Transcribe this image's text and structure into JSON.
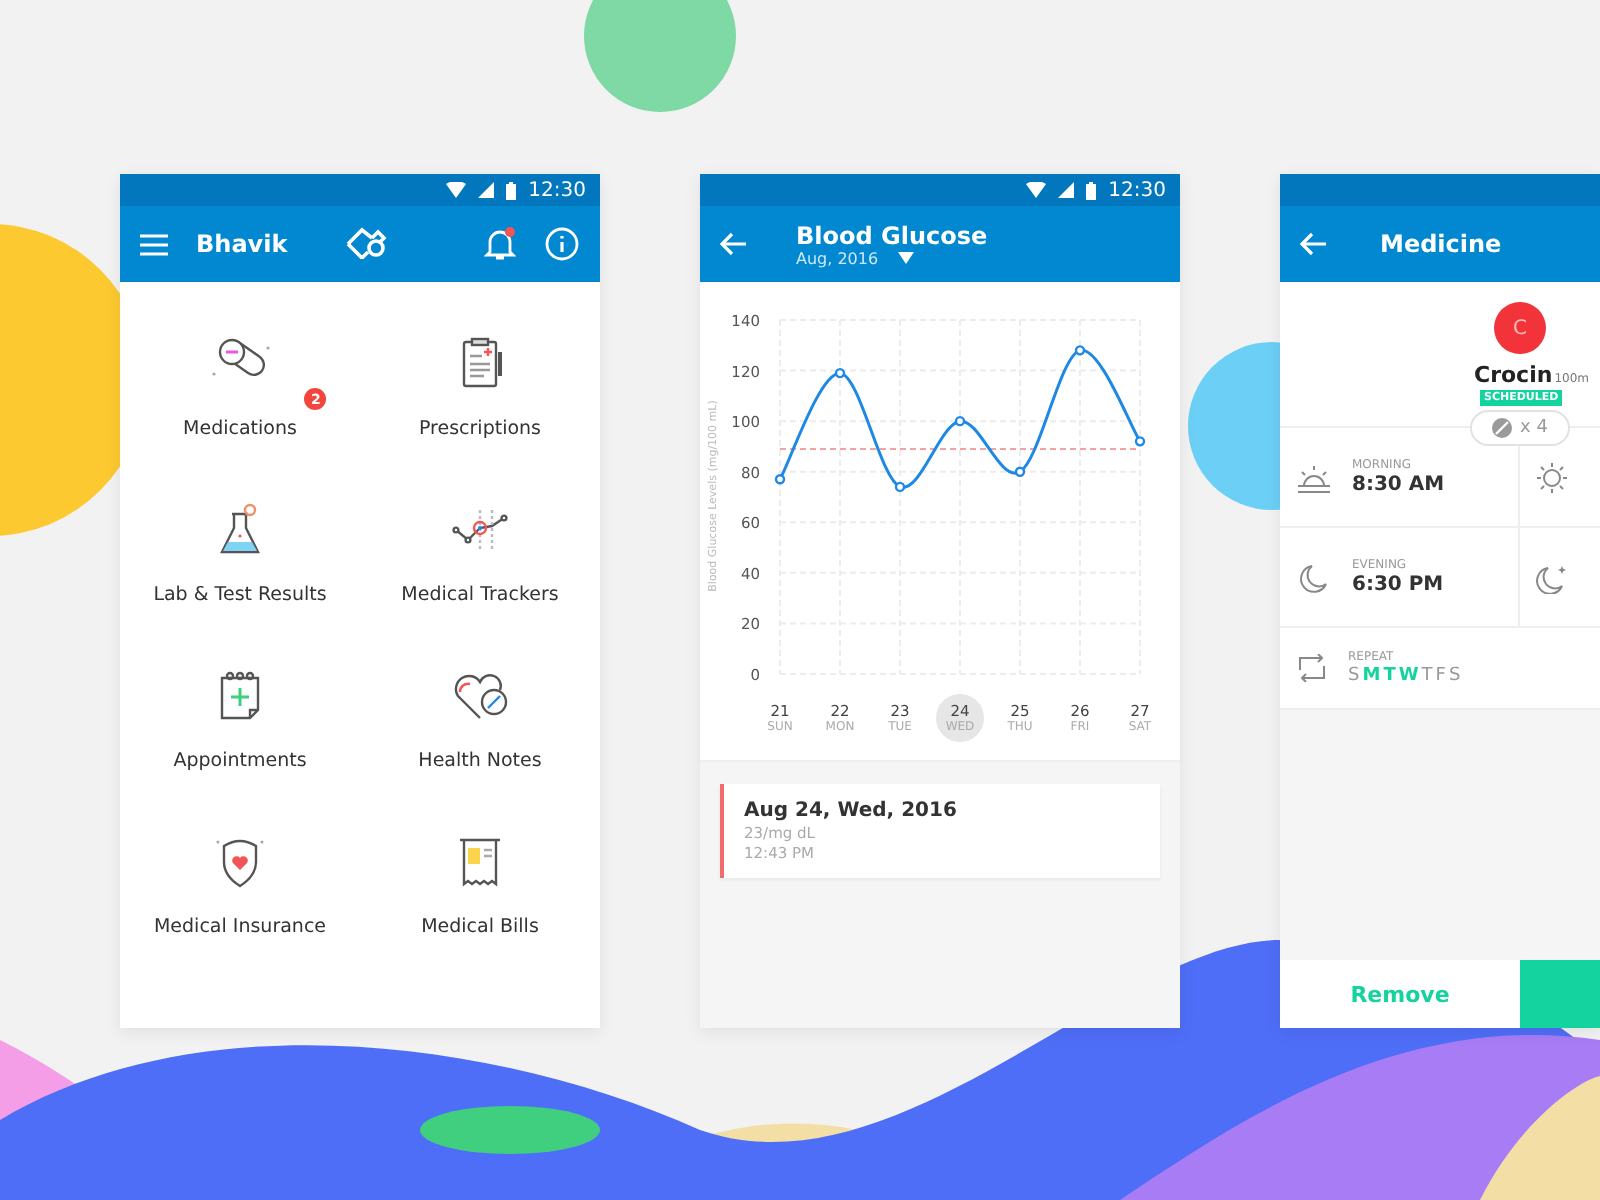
{
  "home_screen": {
    "status_bar": {
      "time": "12:30"
    },
    "app_bar": {
      "title": "Bhavik",
      "notification_dot": true
    },
    "tiles": [
      {
        "kind": "pills",
        "label": "Medications",
        "badge": "2"
      },
      {
        "kind": "clipboard",
        "label": "Prescriptions"
      },
      {
        "kind": "flask",
        "label": "Lab & Test Results"
      },
      {
        "kind": "tracker",
        "label": "Medical Trackers"
      },
      {
        "kind": "calendar",
        "label": "Appointments"
      },
      {
        "kind": "heart-pen",
        "label": "Health Notes"
      },
      {
        "kind": "shield",
        "label": "Medical Insurance"
      },
      {
        "kind": "bill",
        "label": "Medical Bills"
      }
    ]
  },
  "glucose_screen": {
    "status_bar": {
      "time": "12:30"
    },
    "app_bar": {
      "title": "Blood Glucose",
      "subtitle": "Aug, 2016"
    },
    "chart_data": {
      "type": "line",
      "ylabel": "Blood Glucose Levels (mg/100 mL)",
      "categories": [
        "21",
        "22",
        "23",
        "24",
        "25",
        "26",
        "27"
      ],
      "series": [
        {
          "color": "#1e88e5",
          "marker": "o",
          "values": [
            77,
            119,
            74,
            100,
            80,
            128,
            92
          ]
        }
      ],
      "ylim": [
        0,
        140
      ],
      "yticks": [
        0,
        20,
        40,
        60,
        80,
        100,
        120,
        140
      ],
      "grid": true,
      "ref_lines": [
        {
          "axis": "y",
          "value": 89,
          "color": "#f4a3a3"
        }
      ]
    },
    "weekdays": [
      {
        "label": "SUN",
        "selected": false
      },
      {
        "label": "MON",
        "selected": false
      },
      {
        "label": "TUE",
        "selected": false
      },
      {
        "label": "WED",
        "selected": true
      },
      {
        "label": "THU",
        "selected": false
      },
      {
        "label": "FRI",
        "selected": false
      },
      {
        "label": "SAT",
        "selected": false
      }
    ],
    "reading": {
      "date": "Aug 24, Wed, 2016",
      "value": "23/mg dL",
      "time": "12:43 PM"
    }
  },
  "medicine_screen": {
    "app_bar": {
      "title": "Medicine"
    },
    "medicine": {
      "initial": "C",
      "name": "Crocin",
      "strength": "100m",
      "status": "SCHEDULED",
      "quantity": "x 4"
    },
    "doses": [
      {
        "kind": "sunrise",
        "period": "MORNING",
        "time": "8:30 AM"
      },
      {
        "kind": "sun"
      },
      {
        "kind": "moon",
        "period": "EVENING",
        "time": "6:30 PM"
      },
      {
        "kind": "moon-star"
      }
    ],
    "repeat": {
      "label": "REPEAT",
      "days": [
        {
          "letter": "S",
          "on": false
        },
        {
          "letter": "M",
          "on": true
        },
        {
          "letter": "T",
          "on": true
        },
        {
          "letter": "W",
          "on": true
        },
        {
          "letter": "T",
          "on": false
        },
        {
          "letter": "F",
          "on": false
        },
        {
          "letter": "S",
          "on": false
        }
      ]
    },
    "remove_button": "Remove"
  }
}
